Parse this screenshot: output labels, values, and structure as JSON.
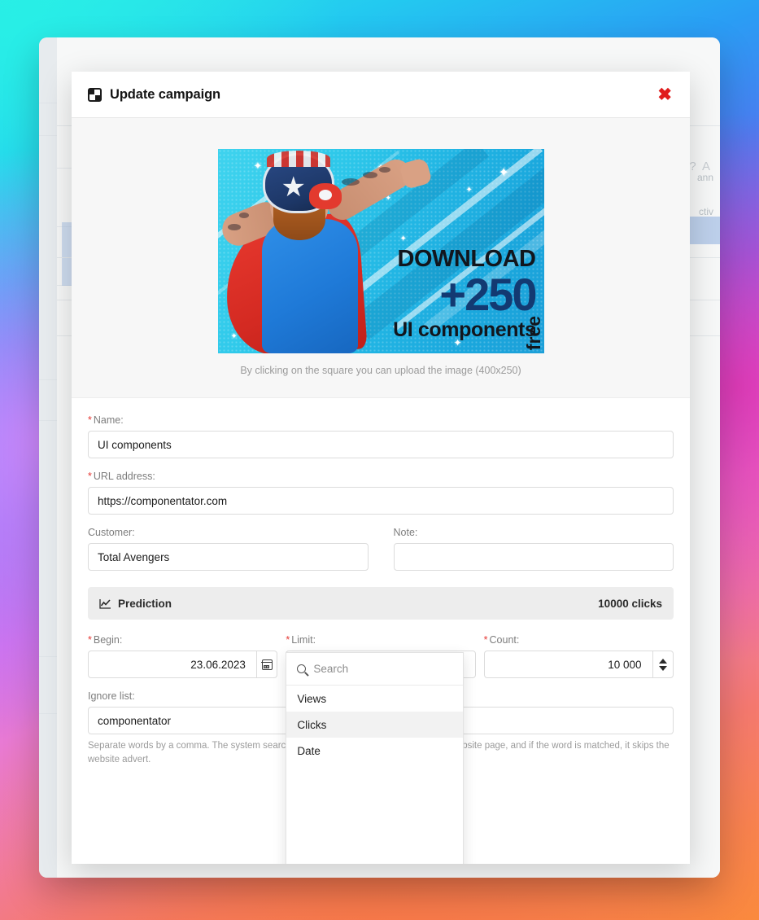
{
  "background_app": {
    "topbar_fragment": "? A",
    "row_fragments": [
      "ann",
      "ctiv"
    ]
  },
  "modal": {
    "title": "Update campaign",
    "title_icon": "checkerboard-square-icon",
    "close_icon": "close-icon",
    "upload": {
      "caption": "By clicking on the square you can upload the image (400x250)",
      "banner": {
        "line1": "DOWNLOAD",
        "line2": "+250",
        "line3": "UI components",
        "badge": "free"
      }
    },
    "fields": {
      "name": {
        "label": "Name:",
        "required": true,
        "value": "UI components"
      },
      "url": {
        "label": "URL address:",
        "required": true,
        "value": "https://componentator.com"
      },
      "customer": {
        "label": "Customer:",
        "required": false,
        "value": "Total Avengers"
      },
      "note": {
        "label": "Note:",
        "required": false,
        "value": "",
        "placeholder": ""
      },
      "begin": {
        "label": "Begin:",
        "required": true,
        "value": "23.06.2023",
        "icon": "calendar-icon"
      },
      "limit": {
        "label": "Limit:",
        "required": true,
        "value": ""
      },
      "count": {
        "label": "Count:",
        "required": true,
        "value": "10 000",
        "icon": "spinner-arrows-icon"
      },
      "ignore_list": {
        "label": "Ignore list:",
        "required": false,
        "value": "componentator"
      }
    },
    "prediction": {
      "icon": "chart-line-icon",
      "title": "Prediction",
      "value": "10000 clicks"
    },
    "hint": "Separate words by a comma. The system searches the word in the URL address of the website page, and if the word is matched, it skips the website advert.",
    "dropdown": {
      "search_placeholder": "Search",
      "search_value": "",
      "search_icon": "search-icon",
      "options": [
        {
          "label": "Views",
          "active": false
        },
        {
          "label": "Clicks",
          "active": true
        },
        {
          "label": "Date",
          "active": false
        }
      ]
    }
  },
  "colors": {
    "required_marker": "#e53935",
    "close": "#e01b1b",
    "prediction_bg": "#ededed",
    "banner_accent": "#133a72"
  }
}
